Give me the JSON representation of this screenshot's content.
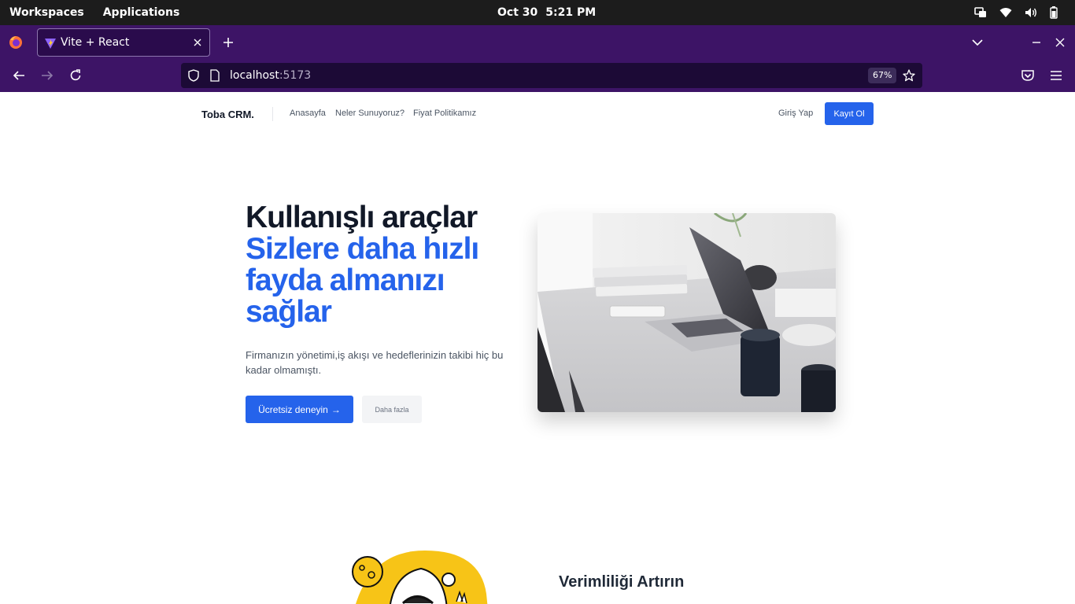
{
  "os": {
    "workspaces": "Workspaces",
    "applications": "Applications",
    "date": "Oct 30",
    "time": "5:21 PM"
  },
  "browser": {
    "tab_title": "Vite + React",
    "url_host": "localhost",
    "url_port": ":5173",
    "zoom": "67%"
  },
  "site": {
    "brand": "Toba CRM.",
    "nav": [
      "Anasayfa",
      "Neler Sunuyoruz?",
      "Fiyat Politikamız"
    ],
    "login": "Giriş Yap",
    "signup": "Kayıt Ol",
    "hero": {
      "line1": "Kullanışlı araçlar",
      "line2": "Sizlere daha hızlı",
      "line3": "fayda almanızı",
      "line4": "sağlar",
      "description": "Firmanızın yönetimi,iş akışı ve hedeflerinizin takibi hiç bu kadar olmamıştı.",
      "cta_primary": "Ücretsiz deneyin",
      "cta_primary_arrow": "→",
      "cta_secondary": "Daha fazla"
    },
    "feature": {
      "title": "Verimliliği Artırın"
    }
  },
  "colors": {
    "accent": "#2563eb",
    "browser_chrome": "#3d1466",
    "os_bar": "#1c1c1c"
  }
}
